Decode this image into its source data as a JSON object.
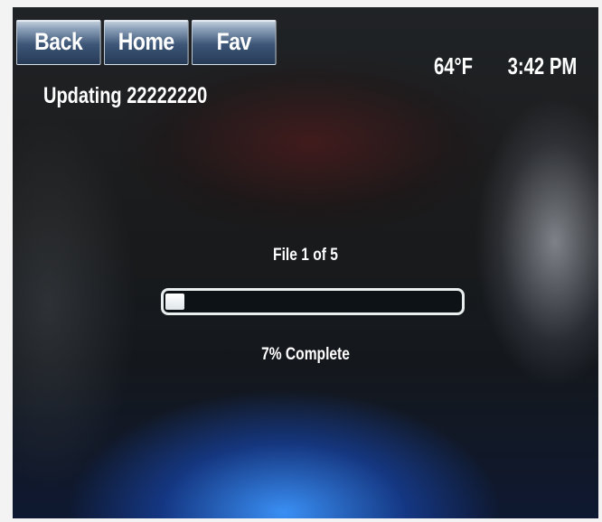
{
  "nav": {
    "back_label": "Back",
    "home_label": "Home",
    "fav_label": "Fav"
  },
  "status": {
    "temperature": "64°F",
    "time": "3:42 PM"
  },
  "update": {
    "title": "Updating 22222220",
    "file_status": "File 1 of 5",
    "progress_percent": 7,
    "progress_text": "7% Complete"
  },
  "colors": {
    "button_gradient_top": "#c7d2df",
    "button_gradient_bottom": "#263a56",
    "progress_fill": "#ffffff",
    "text": "#ffffff"
  }
}
